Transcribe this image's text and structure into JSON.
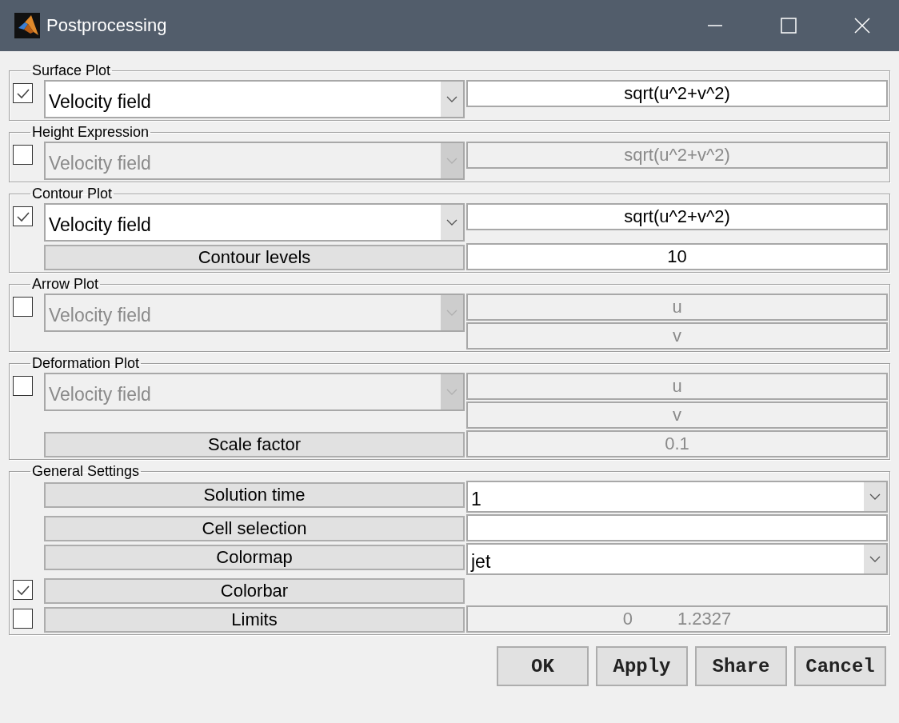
{
  "window": {
    "title": "Postprocessing"
  },
  "sections": [
    {
      "title": "Surface Plot",
      "rows": [
        {
          "checkbox": {
            "checked": true
          },
          "left": {
            "kind": "dropdown",
            "text": "Velocity field",
            "disabled": false
          },
          "right": [
            {
              "kind": "field",
              "value": "sqrt(u^2+v^2)",
              "disabled": false
            }
          ]
        }
      ]
    },
    {
      "title": "Height Expression",
      "rows": [
        {
          "checkbox": {
            "checked": false
          },
          "left": {
            "kind": "dropdown",
            "text": "Velocity field",
            "disabled": true
          },
          "right": [
            {
              "kind": "field",
              "value": "sqrt(u^2+v^2)",
              "disabled": true
            }
          ]
        }
      ]
    },
    {
      "title": "Contour Plot",
      "rows": [
        {
          "checkbox": {
            "checked": true
          },
          "left": {
            "kind": "dropdown",
            "text": "Velocity field",
            "disabled": false
          },
          "right": [
            {
              "kind": "field",
              "value": "sqrt(u^2+v^2)",
              "disabled": false
            }
          ]
        },
        {
          "left": {
            "kind": "label",
            "text": "Contour levels"
          },
          "right": [
            {
              "kind": "field",
              "value": "10",
              "disabled": false
            }
          ]
        }
      ]
    },
    {
      "title": "Arrow Plot",
      "rows": [
        {
          "checkbox": {
            "checked": false
          },
          "left": {
            "kind": "dropdown",
            "text": "Velocity field",
            "disabled": true
          },
          "right": [
            {
              "kind": "field",
              "value": "u",
              "disabled": true
            },
            {
              "kind": "field",
              "value": "v",
              "disabled": true
            }
          ]
        }
      ]
    },
    {
      "title": "Deformation Plot",
      "rows": [
        {
          "checkbox": {
            "checked": false
          },
          "left": {
            "kind": "dropdown",
            "text": "Velocity field",
            "disabled": true
          },
          "right": [
            {
              "kind": "field",
              "value": "u",
              "disabled": true
            },
            {
              "kind": "field",
              "value": "v",
              "disabled": true
            }
          ]
        },
        {
          "left": {
            "kind": "label",
            "text": "Scale factor"
          },
          "right": [
            {
              "kind": "field",
              "value": "0.1",
              "disabled": true
            }
          ]
        }
      ]
    },
    {
      "title": "General Settings",
      "rows": [
        {
          "left": {
            "kind": "label",
            "text": "Solution time"
          },
          "right": [
            {
              "kind": "dropdown",
              "value": "1",
              "disabled": false
            }
          ]
        },
        {
          "left": {
            "kind": "label",
            "text": "Cell selection"
          },
          "right": [
            {
              "kind": "field",
              "disabled": false
            }
          ]
        },
        {
          "left": {
            "kind": "label",
            "text": "Colormap"
          },
          "right": [
            {
              "kind": "dropdown",
              "value": "jet",
              "disabled": false
            }
          ]
        },
        {
          "checkbox": {
            "checked": true
          },
          "left": {
            "kind": "label",
            "text": "Colorbar"
          },
          "right": [
            {
              "kind": "none"
            }
          ]
        },
        {
          "checkbox": {
            "checked": false
          },
          "left": {
            "kind": "label",
            "text": "Limits"
          },
          "right": [
            {
              "kind": "field",
              "value": "0 1.2327",
              "disabled": true
            }
          ]
        }
      ]
    }
  ],
  "buttons": [
    "OK",
    "Apply",
    "Share",
    "Cancel"
  ]
}
